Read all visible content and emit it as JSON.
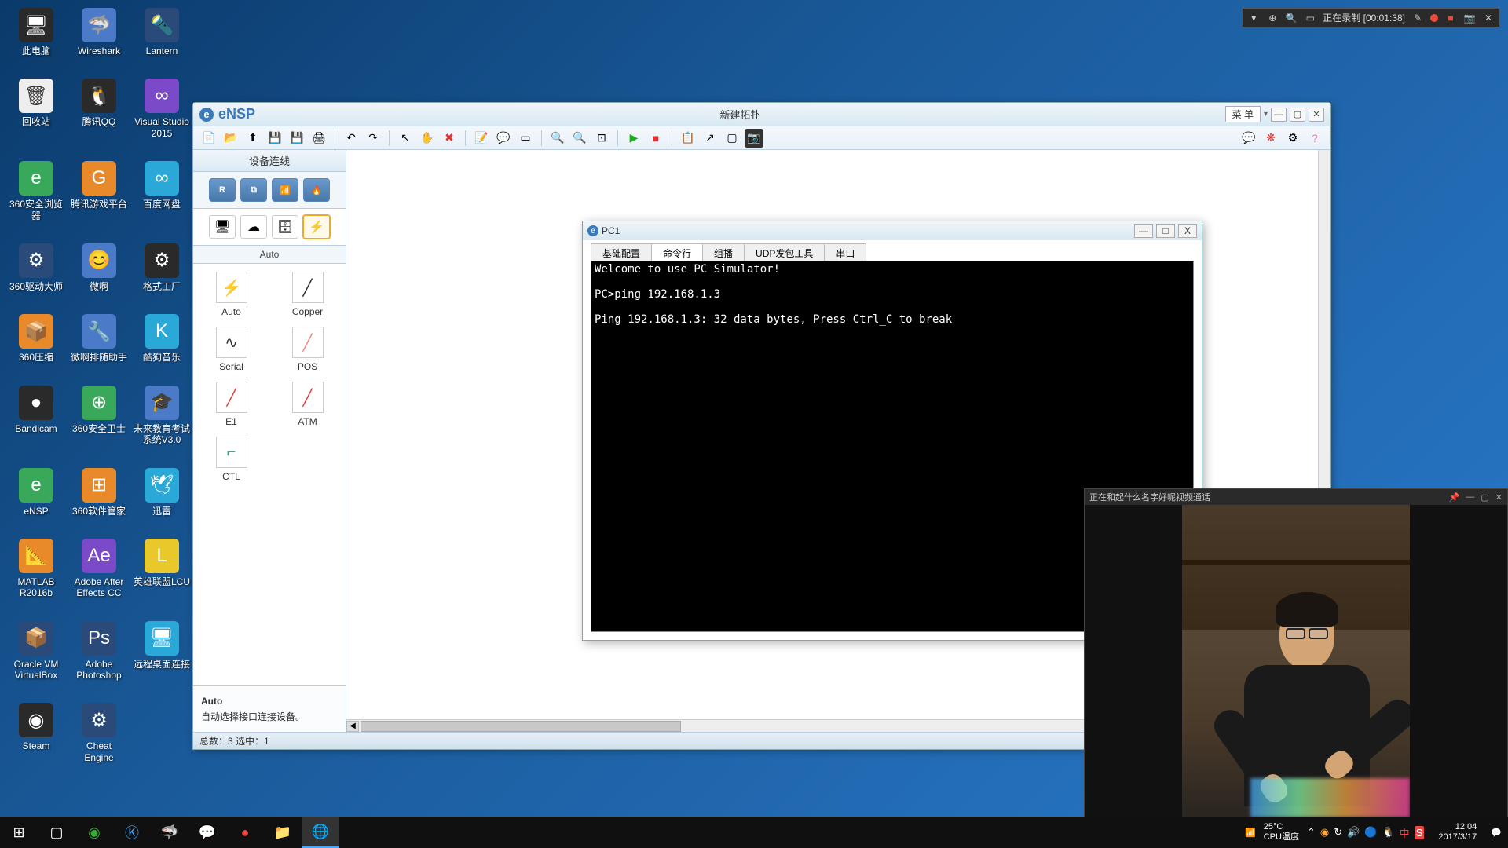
{
  "desktop": {
    "icons": [
      {
        "label": "此电脑",
        "glyph": "🖥",
        "cls": "ic-dark"
      },
      {
        "label": "Wireshark",
        "glyph": "🦈",
        "cls": "ic-blue"
      },
      {
        "label": "Lantern",
        "glyph": "🔦",
        "cls": "ic-navy"
      },
      {
        "label": "回收站",
        "glyph": "🗑",
        "cls": "ic-white"
      },
      {
        "label": "腾讯QQ",
        "glyph": "🐧",
        "cls": "ic-dark"
      },
      {
        "label": "Visual Studio 2015",
        "glyph": "∞",
        "cls": "ic-purple"
      },
      {
        "label": "360安全浏览器",
        "glyph": "e",
        "cls": "ic-green"
      },
      {
        "label": "腾讯游戏平台",
        "glyph": "G",
        "cls": "ic-orange"
      },
      {
        "label": "百度网盘",
        "glyph": "∞",
        "cls": "ic-cyan"
      },
      {
        "label": "360驱动大师",
        "glyph": "⚙",
        "cls": "ic-navy"
      },
      {
        "label": "微啊",
        "glyph": "😊",
        "cls": "ic-blue"
      },
      {
        "label": "格式工厂",
        "glyph": "⚙",
        "cls": "ic-dark"
      },
      {
        "label": "360压缩",
        "glyph": "📦",
        "cls": "ic-orange"
      },
      {
        "label": "微啊排随助手",
        "glyph": "🔧",
        "cls": "ic-blue"
      },
      {
        "label": "酷狗音乐",
        "glyph": "K",
        "cls": "ic-cyan"
      },
      {
        "label": "Bandicam",
        "glyph": "●",
        "cls": "ic-dark"
      },
      {
        "label": "360安全卫士",
        "glyph": "⊕",
        "cls": "ic-green"
      },
      {
        "label": "未来教育考试系统V3.0",
        "glyph": "🎓",
        "cls": "ic-blue"
      },
      {
        "label": "eNSP",
        "glyph": "e",
        "cls": "ic-green"
      },
      {
        "label": "360软件管家",
        "glyph": "⊞",
        "cls": "ic-orange"
      },
      {
        "label": "迅雷",
        "glyph": "🕊",
        "cls": "ic-cyan"
      },
      {
        "label": "MATLAB R2016b",
        "glyph": "📐",
        "cls": "ic-orange"
      },
      {
        "label": "Adobe After Effects CC",
        "glyph": "Ae",
        "cls": "ic-purple"
      },
      {
        "label": "英雄联盟LCU",
        "glyph": "L",
        "cls": "ic-yellow"
      },
      {
        "label": "Oracle VM VirtualBox",
        "glyph": "📦",
        "cls": "ic-navy"
      },
      {
        "label": "Adobe Photoshop",
        "glyph": "Ps",
        "cls": "ic-navy"
      },
      {
        "label": "远程桌面连接",
        "glyph": "🖥",
        "cls": "ic-cyan"
      },
      {
        "label": "Steam",
        "glyph": "◉",
        "cls": "ic-dark"
      },
      {
        "label": "Cheat Engine",
        "glyph": "⚙",
        "cls": "ic-navy"
      }
    ]
  },
  "recordbar": {
    "status": "正在录制 [00:01:38]"
  },
  "ensp": {
    "app_name": "eNSP",
    "title": "新建拓扑",
    "menu_btn": "菜 单",
    "sidebar": {
      "header": "设备连线",
      "sublabel": "Auto",
      "cables": [
        {
          "label": "Auto",
          "glyph": "⚡"
        },
        {
          "label": "Copper",
          "glyph": "╱"
        },
        {
          "label": "Serial",
          "glyph": "∿"
        },
        {
          "label": "POS",
          "glyph": "╱"
        },
        {
          "label": "E1",
          "glyph": "╱"
        },
        {
          "label": "ATM",
          "glyph": "╱"
        },
        {
          "label": "CTL",
          "glyph": "⌐"
        }
      ],
      "desc_title": "Auto",
      "desc_text": "自动选择接口连接设备。"
    },
    "status": "总数：3  选中：1"
  },
  "pc1": {
    "title": "PC1",
    "tabs": [
      "基础配置",
      "命令行",
      "组播",
      "UDP发包工具",
      "串口"
    ],
    "active_tab": 1,
    "terminal": "Welcome to use PC Simulator!\n\nPC>ping 192.168.1.3\n\nPing 192.168.1.3: 32 data bytes, Press Ctrl_C to break\n"
  },
  "video": {
    "title": "正在和起什么名字好呢视频通话"
  },
  "taskbar": {
    "temp": "25°C",
    "temp_label": "CPU温度",
    "time": "12:04",
    "date": "2017/3/17"
  }
}
